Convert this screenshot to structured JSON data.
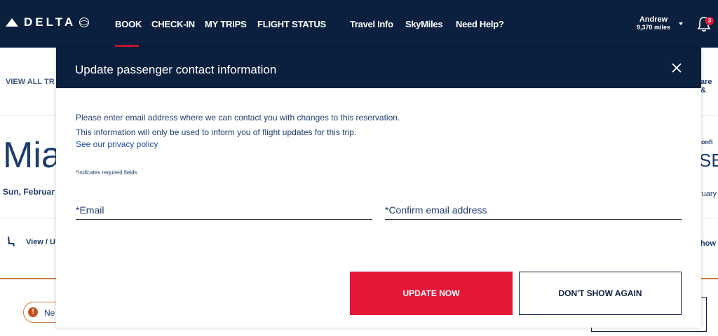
{
  "brand": {
    "name": "DELTA"
  },
  "nav": {
    "main": [
      {
        "label": "BOOK"
      },
      {
        "label": "CHECK-IN"
      },
      {
        "label": "MY TRIPS"
      },
      {
        "label": "FLIGHT STATUS"
      }
    ],
    "secondary": [
      {
        "label": "Travel Info"
      },
      {
        "label": "SkyMiles"
      },
      {
        "label": "Need Help?"
      }
    ]
  },
  "user": {
    "name": "Andrew",
    "miles": "9,370 miles",
    "notifications": "3"
  },
  "background": {
    "view_all": "VIEW ALL TR",
    "right_top": "are &",
    "city": "Mia",
    "right_code": "SB",
    "right_confirm": "onfi",
    "date": "Sun, Februar",
    "right_date": "ruary",
    "view_link": "View / U",
    "right_show": "how",
    "notice": "Ne"
  },
  "modal": {
    "title": "Update passenger contact information",
    "intro_line1": "Please enter email address where we can contact you with changes to this reservation.",
    "intro_line2": "This information will only be used to inform you of flight updates for this trip.",
    "privacy_link": "See our privacy policy",
    "required_note": "*Indicates required fields",
    "email_placeholder": "*Email",
    "confirm_placeholder": "*Confirm email address",
    "primary_button": "UPDATE NOW",
    "secondary_button": "DON'T SHOW AGAIN"
  },
  "colors": {
    "navy": "#0b1f3f",
    "accent_red": "#e31837",
    "link_blue": "#1d4fa0"
  }
}
